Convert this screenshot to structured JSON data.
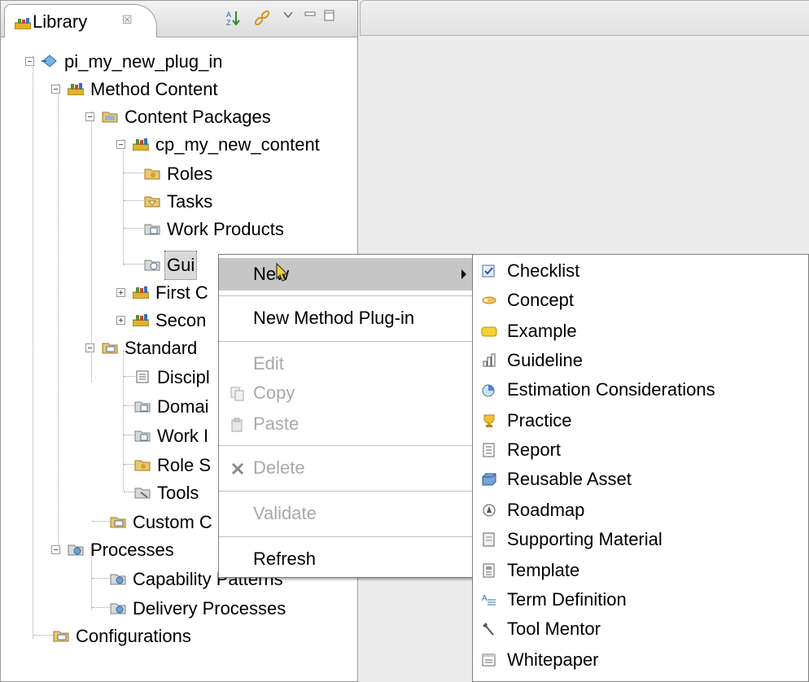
{
  "library_view": {
    "tab_label": "Library",
    "tab_close": "☒"
  },
  "tree": {
    "plugin": "pi_my_new_plug_in",
    "method_content": "Method Content",
    "content_packages": "Content Packages",
    "cp": "cp_my_new_content",
    "roles": "Roles",
    "tasks": "Tasks",
    "work_products": "Work Products",
    "guidance": "Gui",
    "first": "First C",
    "second": "Secon",
    "standard": "Standard",
    "disciplines": "Discipl",
    "domains": "Domai",
    "work": "Work I",
    "role_sets": "Role S",
    "tools": "Tools",
    "custom": "Custom C",
    "processes": "Processes",
    "capability_patterns": "Capability Patterns",
    "delivery_processes": "Delivery Processes",
    "configurations": "Configurations"
  },
  "context_menu": {
    "new": "New",
    "new_method_plugin": "New Method Plug-in",
    "edit": "Edit",
    "copy": "Copy",
    "paste": "Paste",
    "delete": "Delete",
    "validate": "Validate",
    "refresh": "Refresh"
  },
  "submenu": [
    {
      "label": "Checklist",
      "icon": "checklist-icon"
    },
    {
      "label": "Concept",
      "icon": "concept-icon"
    },
    {
      "label": "Example",
      "icon": "example-icon"
    },
    {
      "label": "Guideline",
      "icon": "guideline-icon"
    },
    {
      "label": "Estimation Considerations",
      "icon": "estimation-icon"
    },
    {
      "label": "Practice",
      "icon": "practice-icon"
    },
    {
      "label": "Report",
      "icon": "report-icon"
    },
    {
      "label": "Reusable Asset",
      "icon": "reusable-asset-icon"
    },
    {
      "label": "Roadmap",
      "icon": "roadmap-icon"
    },
    {
      "label": "Supporting Material",
      "icon": "supporting-material-icon"
    },
    {
      "label": "Template",
      "icon": "template-icon"
    },
    {
      "label": "Term Definition",
      "icon": "term-definition-icon"
    },
    {
      "label": "Tool Mentor",
      "icon": "tool-mentor-icon"
    },
    {
      "label": "Whitepaper",
      "icon": "whitepaper-icon"
    }
  ],
  "colors": {
    "menu_highlight": "#c6c6c6",
    "disabled_text": "#a9a9a9",
    "package_yellow": "#f2d36b"
  }
}
